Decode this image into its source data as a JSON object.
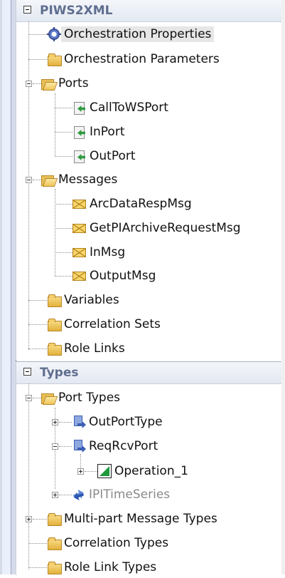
{
  "orchestration": {
    "title": "PIWS2XML",
    "items": {
      "properties": "Orchestration Properties",
      "parameters": "Orchestration Parameters",
      "ports": "Ports",
      "ports_children": [
        "CallToWSPort",
        "InPort",
        "OutPort"
      ],
      "messages": "Messages",
      "messages_children": [
        "ArcDataRespMsg",
        "GetPIArchiveRequestMsg",
        "InMsg",
        "OutputMsg"
      ],
      "variables": "Variables",
      "correlation_sets": "Correlation Sets",
      "role_links": "Role Links"
    }
  },
  "types": {
    "title": "Types",
    "items": {
      "port_types": "Port Types",
      "outporttype": "OutPortType",
      "reqrcvport": "ReqRcvPort",
      "operation_1": "Operation_1",
      "ipitimeseries": "IPITimeSeries",
      "multipart_message_types": "Multi-part Message Types",
      "correlation_types": "Correlation Types",
      "role_link_types": "Role Link Types"
    }
  },
  "icons": {
    "folder": "folder-icon",
    "gear": "gear-icon",
    "port": "port-icon",
    "message": "envelope-icon",
    "porttype": "port-type-icon",
    "operation": "operation-icon"
  }
}
